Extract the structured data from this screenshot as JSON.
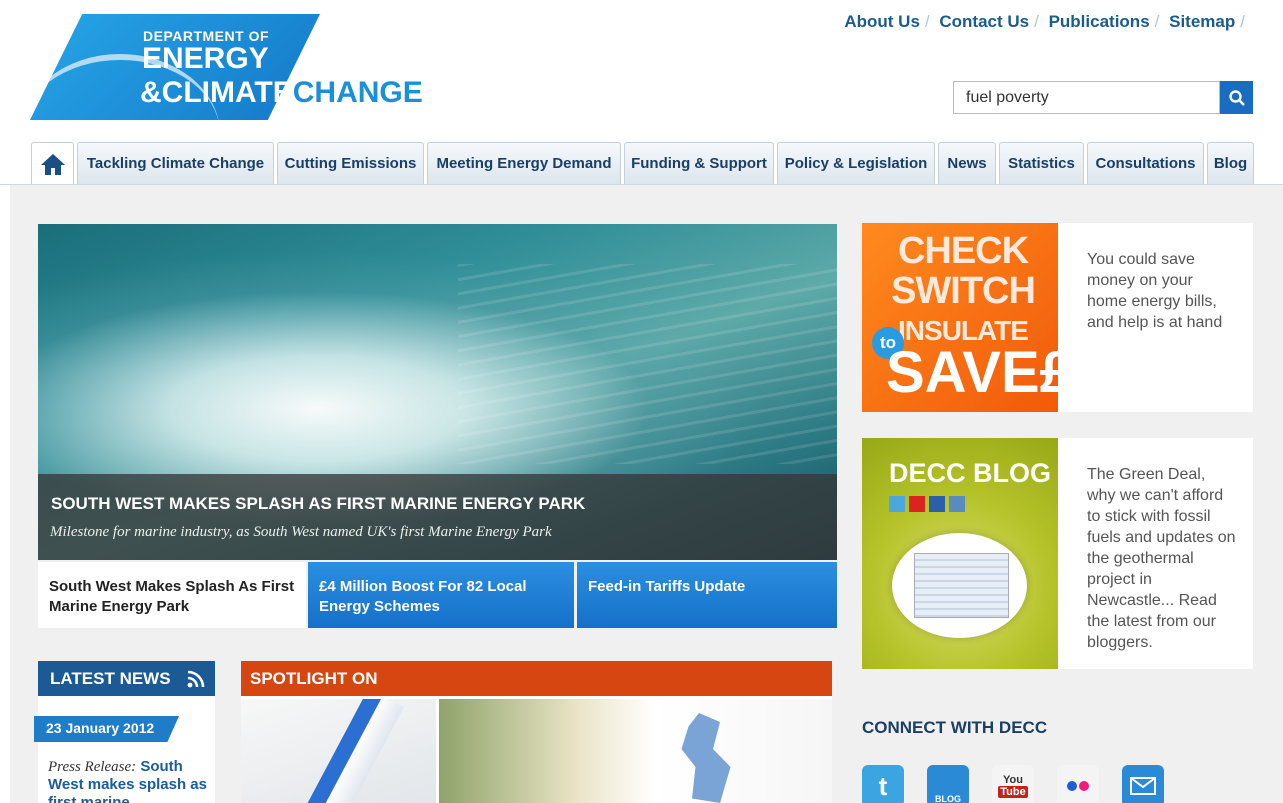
{
  "logo": {
    "line1": "DEPARTMENT OF",
    "line2": "ENERGY",
    "line3a": "&CLIMATE",
    "line3b": "CHANGE"
  },
  "toplinks": [
    "About Us",
    "Contact Us",
    "Publications",
    "Sitemap"
  ],
  "search": {
    "value": "fuel poverty"
  },
  "nav": [
    "Tackling Climate Change",
    "Cutting Emissions",
    "Meeting Energy Demand",
    "Funding & Support",
    "Policy & Legislation",
    "News",
    "Statistics",
    "Consultations",
    "Blog"
  ],
  "hero": {
    "title": "SOUTH WEST MAKES SPLASH AS FIRST MARINE ENERGY PARK",
    "subtitle": "Milestone for marine industry, as South West named UK's first Marine Energy Park"
  },
  "slides": [
    "South West Makes Splash As First Marine Energy Park",
    "£4 Million Boost For 82 Local Energy Schemes",
    "Feed-in Tariffs Update"
  ],
  "latest_news": {
    "heading": "LATEST NEWS",
    "date": "23 January 2012",
    "prefix": "Press Release:",
    "link": "South West makes splash as first marine"
  },
  "spotlight": {
    "heading": "SPOTLIGHT ON"
  },
  "promo1": {
    "check": "CHECK",
    "switch": "SWITCH",
    "insulate": "INSULATE",
    "to": "to",
    "save": "SAVE£",
    "text": "You could save money on your home energy bills, and help is at hand"
  },
  "promo2": {
    "title": "DECC BLOG",
    "text": "The Green Deal, why we can't afford to stick with fossil fuels and updates on the geothermal project in Newcastle... Read the latest from our bloggers."
  },
  "connect": {
    "heading": "CONNECT WITH DECC",
    "twitter_glyph": "t",
    "blog_label": "BLOG",
    "youtube_top": "You",
    "youtube_bottom": "Tube"
  }
}
